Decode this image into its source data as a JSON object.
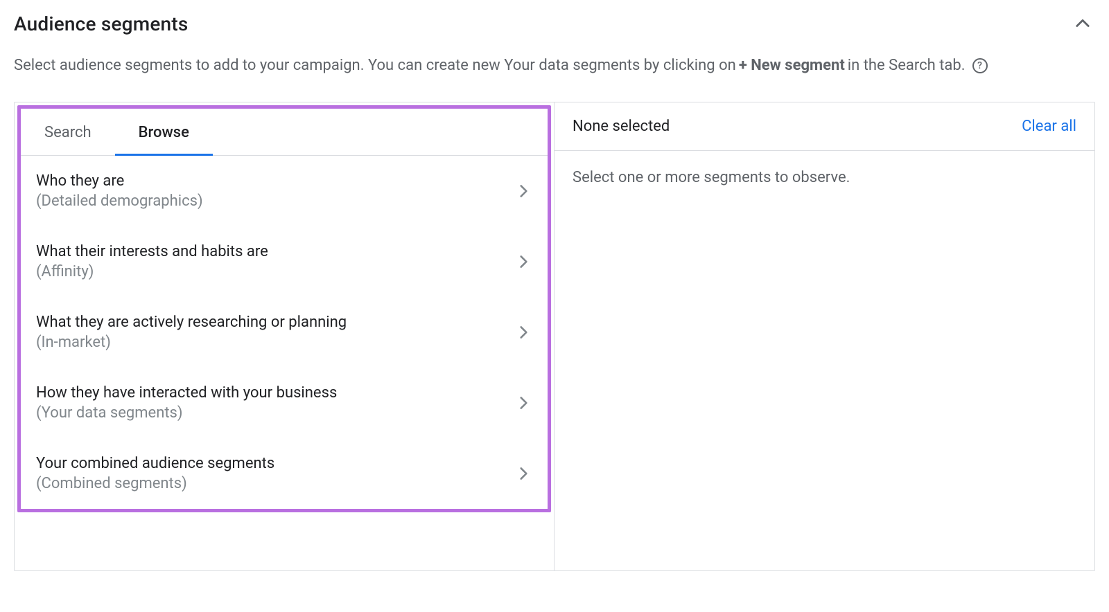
{
  "header": {
    "title": "Audience segments"
  },
  "description": {
    "pre": "Select audience segments to add to your campaign. You can create new Your data segments by clicking on ",
    "bold": "+ New segment",
    "post": " in the Search tab."
  },
  "tabs": {
    "search": "Search",
    "browse": "Browse",
    "active": "browse"
  },
  "browse_items": [
    {
      "title": "Who they are",
      "subtitle": "(Detailed demographics)"
    },
    {
      "title": "What their interests and habits are",
      "subtitle": "(Affinity)"
    },
    {
      "title": "What they are actively researching or planning",
      "subtitle": "(In-market)"
    },
    {
      "title": "How they have interacted with your business",
      "subtitle": "(Your data segments)"
    },
    {
      "title": "Your combined audience segments",
      "subtitle": "(Combined segments)"
    }
  ],
  "selection": {
    "none_label": "None selected",
    "clear_all": "Clear all",
    "body": "Select one or more segments to observe."
  }
}
